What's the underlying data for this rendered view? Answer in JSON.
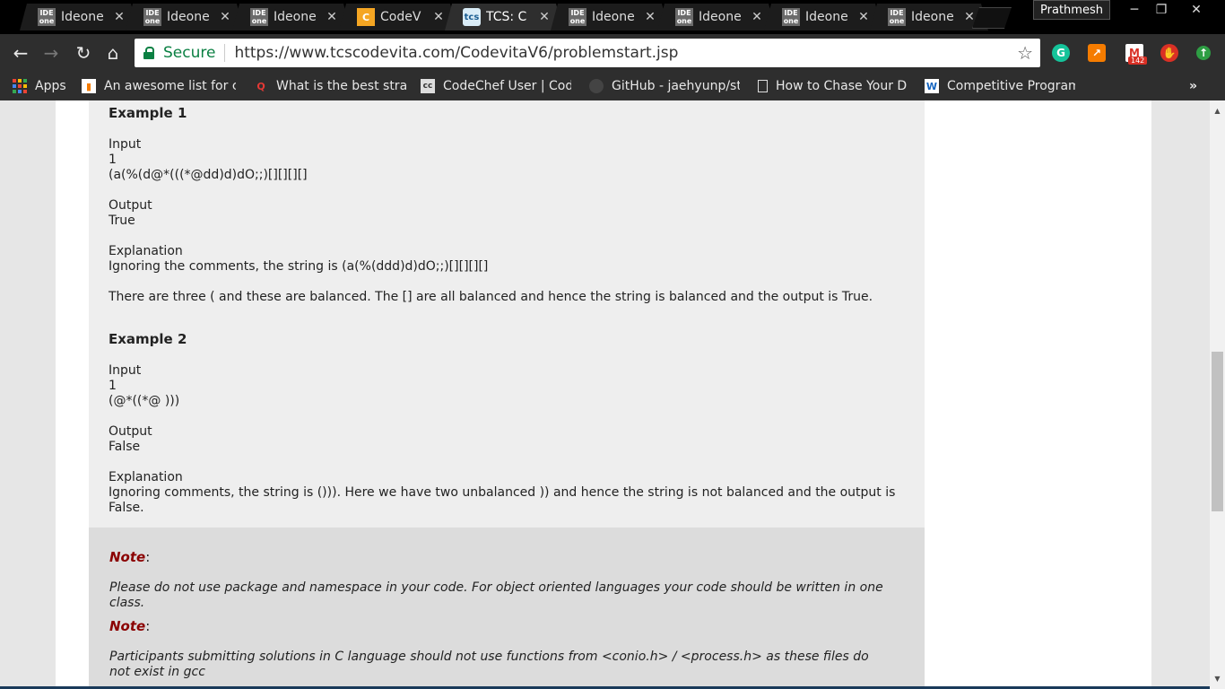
{
  "browser": {
    "tabs": [
      {
        "title": "Ideone",
        "favicon": "IDE one",
        "active": false
      },
      {
        "title": "Ideone",
        "favicon": "IDE one",
        "active": false
      },
      {
        "title": "Ideone",
        "favicon": "IDE one",
        "active": false
      },
      {
        "title": "CodeV",
        "favicon": "C",
        "active": false
      },
      {
        "title": "TCS: C",
        "favicon": "tcs",
        "active": true
      },
      {
        "title": "Ideone",
        "favicon": "IDE one",
        "active": false
      },
      {
        "title": "Ideone",
        "favicon": "IDE one",
        "active": false
      },
      {
        "title": "Ideone",
        "favicon": "IDE one",
        "active": false
      },
      {
        "title": "Ideone",
        "favicon": "IDE one",
        "active": false
      }
    ],
    "profile_name": "Prathmesh",
    "secure_label": "Secure",
    "url": "https://www.tcscodevita.com/CodevitaV6/problemstart.jsp",
    "gmail_badge": "142",
    "bookmarks": [
      {
        "label": "Apps",
        "icon": "apps-grid-icon"
      },
      {
        "label": "An awesome list for c",
        "icon": "chart-icon"
      },
      {
        "label": "What is the best strat",
        "icon": "quora-icon"
      },
      {
        "label": "CodeChef User | Code",
        "icon": "codechef-icon"
      },
      {
        "label": "GitHub - jaehyunp/st",
        "icon": "github-icon"
      },
      {
        "label": "How to Chase Your D",
        "icon": "page-icon"
      },
      {
        "label": "Competitive Program",
        "icon": "w-icon"
      }
    ],
    "overflow_label": "»"
  },
  "page": {
    "example1": {
      "heading": "Example 1",
      "input_label": "Input",
      "input_lines": [
        "1",
        "(a(%(d@*(((*@dd)d)dO;;)[][][][]"
      ],
      "output_label": "Output",
      "output_value": "True",
      "explanation_label": "Explanation",
      "explanation": "Ignoring the comments, the string is (a(%(ddd)d)dO;;)[][][][]",
      "summary": "There are three ( and these are balanced. The [] are all balanced and hence the string is balanced and the output is True."
    },
    "example2": {
      "heading": "Example 2",
      "input_label": "Input",
      "input_lines": [
        "1",
        "(@*((*@ )))"
      ],
      "output_label": "Output",
      "output_value": "False",
      "explanation_label": "Explanation",
      "explanation": "Ignoring comments, the string is ())). Here we have two unbalanced )) and hence the string is not balanced and the output is False."
    },
    "notes": [
      {
        "label": "Note",
        "text": "Please do not use package and namespace in your code. For object oriented languages your code should be written in one class."
      },
      {
        "label": "Note",
        "text": "Participants submitting solutions in C language should not use functions from <conio.h> / <process.h> as these files do not exist in gcc"
      }
    ]
  },
  "colors": {
    "note_label": "#8b0000",
    "secure_green": "#0b8043",
    "chrome_dark": "#2e2e2e"
  }
}
